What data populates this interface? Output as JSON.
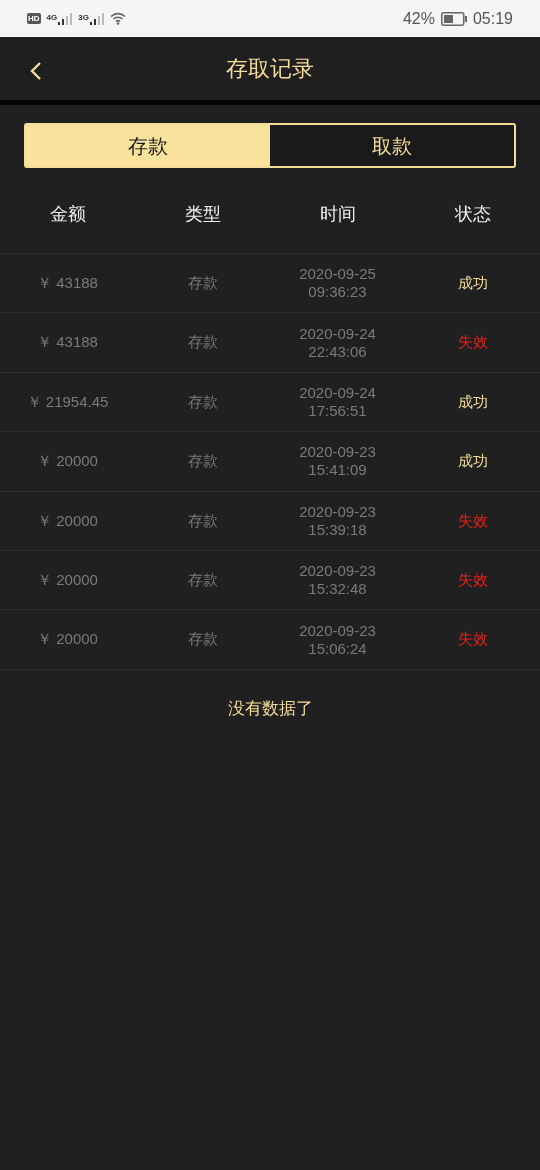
{
  "status_bar": {
    "network_labels": [
      "HD",
      "4G",
      "3G"
    ],
    "battery": "42%",
    "time": "05:19"
  },
  "header": {
    "title": "存取记录"
  },
  "tabs": [
    {
      "label": "存款",
      "selected": true
    },
    {
      "label": "取款",
      "selected": false
    }
  ],
  "table": {
    "columns": [
      "金额",
      "类型",
      "时间",
      "状态"
    ],
    "rows": [
      {
        "amount": "￥ 43188",
        "type": "存款",
        "date": "2020-09-25",
        "time": "09:36:23",
        "status": {
          "text": "成功",
          "kind": "success"
        }
      },
      {
        "amount": "￥ 43188",
        "type": "存款",
        "date": "2020-09-24",
        "time": "22:43:06",
        "status": {
          "text": "失效",
          "kind": "failed"
        }
      },
      {
        "amount": "￥ 21954.45",
        "type": "存款",
        "date": "2020-09-24",
        "time": "17:56:51",
        "status": {
          "text": "成功",
          "kind": "success"
        }
      },
      {
        "amount": "￥ 20000",
        "type": "存款",
        "date": "2020-09-23",
        "time": "15:41:09",
        "status": {
          "text": "成功",
          "kind": "success"
        }
      },
      {
        "amount": "￥ 20000",
        "type": "存款",
        "date": "2020-09-23",
        "time": "15:39:18",
        "status": {
          "text": "失效",
          "kind": "failed"
        }
      },
      {
        "amount": "￥ 20000",
        "type": "存款",
        "date": "2020-09-23",
        "time": "15:32:48",
        "status": {
          "text": "失效",
          "kind": "failed"
        }
      },
      {
        "amount": "￥ 20000",
        "type": "存款",
        "date": "2020-09-23",
        "time": "15:06:24",
        "status": {
          "text": "失效",
          "kind": "failed"
        }
      }
    ]
  },
  "footer_note": "没有数据了"
}
